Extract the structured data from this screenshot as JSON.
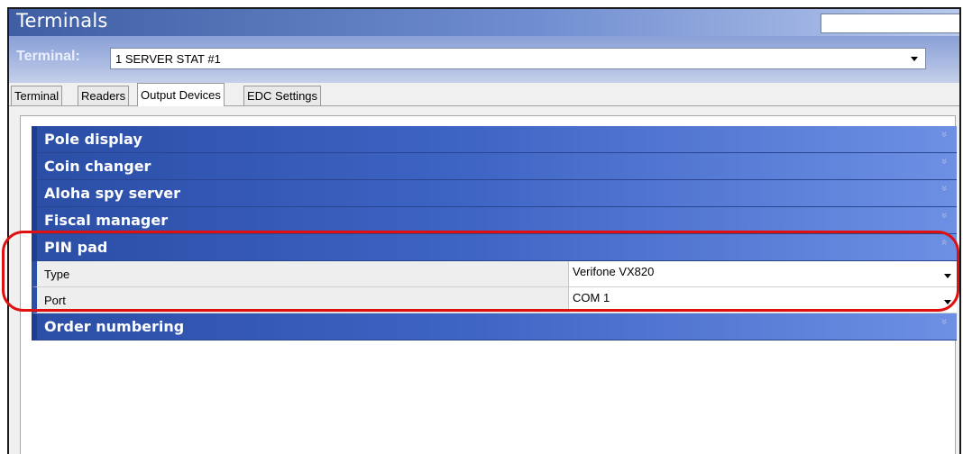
{
  "window": {
    "title": "Terminals"
  },
  "terminal": {
    "label": "Terminal:",
    "selected": "1 SERVER STAT #1"
  },
  "tabs": [
    {
      "label": "Terminal"
    },
    {
      "label": "Readers"
    },
    {
      "label": "Output Devices"
    },
    {
      "label": "EDC Settings"
    }
  ],
  "sections": [
    {
      "label": "Pole display"
    },
    {
      "label": "Coin changer"
    },
    {
      "label": "Aloha spy server"
    },
    {
      "label": "Fiscal manager"
    },
    {
      "label": "PIN pad"
    },
    {
      "label": "Order numbering"
    }
  ],
  "chevrons": {
    "down": "»",
    "up": "«"
  },
  "pin_pad": {
    "rows": [
      {
        "name": "Type",
        "value": "Verifone VX820"
      },
      {
        "name": "Port",
        "value": "COM 1"
      }
    ]
  },
  "colors": {
    "section_blue": "#2b4ea6",
    "highlight_red": "#e01010",
    "title_gradient_start": "#3f5ea3"
  }
}
